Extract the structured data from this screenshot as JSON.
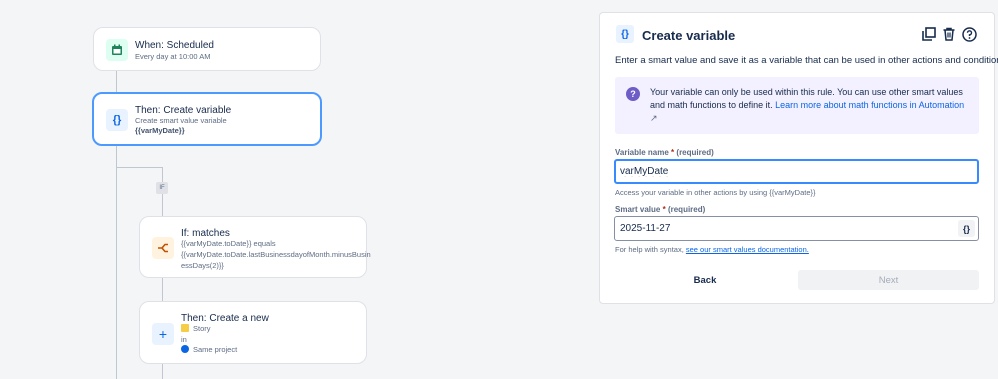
{
  "flow": {
    "trigger": {
      "title": "When: Scheduled",
      "subtitle": "Every day at 10:00 AM"
    },
    "create_variable": {
      "title": "Then: Create variable",
      "subtitle": "Create smart value variable",
      "variable": "{{varMyDate}}"
    },
    "if_badge": "IF",
    "condition": {
      "title": "If: matches",
      "line1": "{{varMyDate.toDate}} equals",
      "line2": "{{varMyDate.toDate.lastBusinessdayofMonth.minusBusin",
      "line3": "essDays(2)}}"
    },
    "create_issue": {
      "title": "Then: Create a new",
      "issue_type": "Story",
      "in_label": "in",
      "project": "Same project"
    }
  },
  "panel": {
    "title": "Create variable",
    "description": "Enter a smart value and save it as a variable that can be used in other actions and conditions.",
    "info": {
      "text": "Your variable can only be used within this rule. You can use other smart values and math functions to define it. ",
      "link": "Learn more about math functions in Automation",
      "link_suffix": "↗"
    },
    "variable_name": {
      "label": "Variable name",
      "required_marker": "*",
      "required_text": "(required)",
      "value": "varMyDate",
      "help": "Access your variable in other actions by using {{varMyDate}}"
    },
    "smart_value": {
      "label": "Smart value",
      "required_marker": "*",
      "required_text": "(required)",
      "value": "2025-11-27",
      "button": "{}",
      "help_prefix": "For help with syntax, ",
      "help_link": "see our smart values documentation."
    },
    "back_label": "Back",
    "next_label": "Next"
  },
  "colors": {
    "accent": "#0c66e4",
    "selected_border": "#4c9aff",
    "info_bg": "#f3f0ff",
    "info_icon": "#6e5dc6"
  }
}
